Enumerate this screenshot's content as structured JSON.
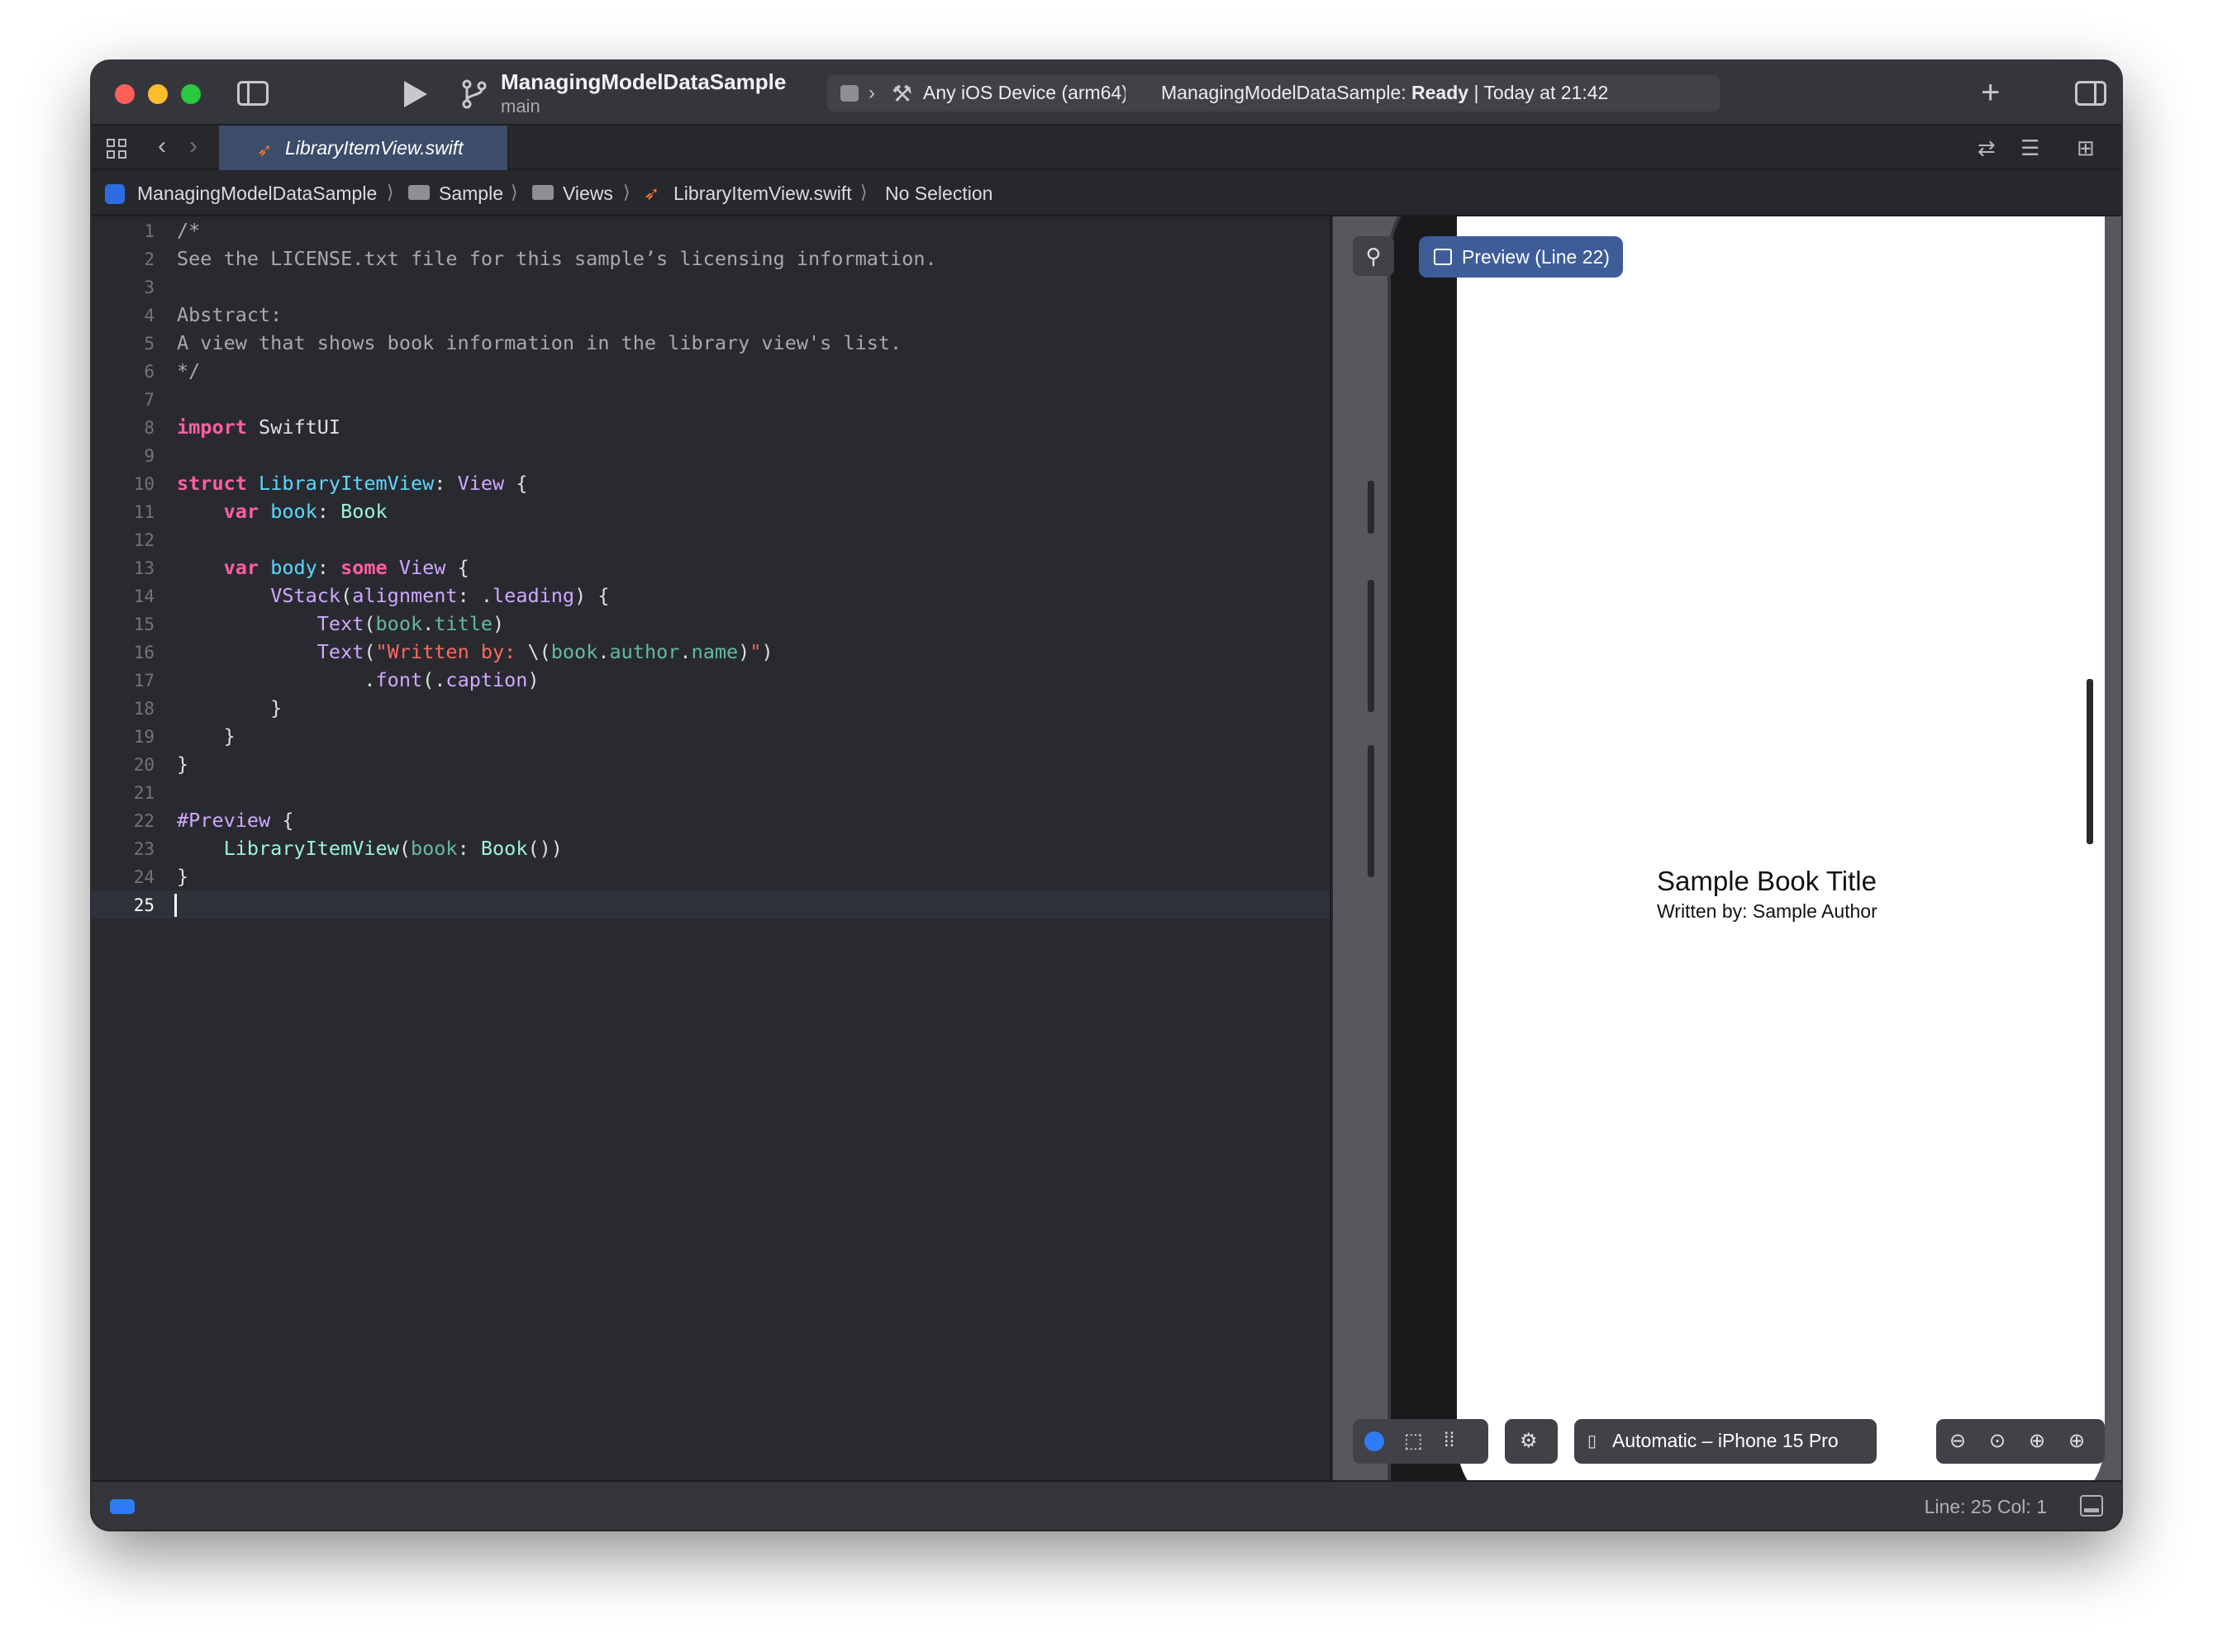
{
  "titlebar": {
    "scheme_name": "ManagingModelDataSample",
    "branch": "main",
    "destination": "Any iOS Device (arm64)",
    "status_project": "ManagingModelDataSample:",
    "status_state": "Ready",
    "status_time": "| Today at 21:42"
  },
  "tab": {
    "label": "LibraryItemView.swift"
  },
  "jumpbar": {
    "items": [
      "ManagingModelDataSample",
      "Sample",
      "Views",
      "LibraryItemView.swift",
      "No Selection"
    ]
  },
  "editor": {
    "current_line": 25,
    "line_numbers": [
      "1",
      "2",
      "3",
      "4",
      "5",
      "6",
      "7",
      "8",
      "9",
      "10",
      "11",
      "12",
      "13",
      "14",
      "15",
      "16",
      "17",
      "18",
      "19",
      "20",
      "21",
      "22",
      "23",
      "24",
      "25"
    ]
  },
  "preview": {
    "pill_label": "Preview (Line 22)",
    "book_title": "Sample Book Title",
    "book_author": "Written by: Sample Author",
    "device_label": "Automatic – iPhone 15 Pro"
  },
  "statusbar": {
    "cursor": "Line: 25  Col: 1"
  },
  "colors": {
    "keyword": "#fc5fa3",
    "type": "#5dd8ff",
    "property": "#67b7a4",
    "string": "#fc6a5d",
    "comment": "#a9a9ad",
    "accent": "#2f7bf5"
  },
  "icons": [
    "sidebar-icon",
    "play-icon",
    "branch-icon",
    "hammer-icon",
    "plus-icon",
    "inspector-icon",
    "grid-icon",
    "chevron-left-icon",
    "chevron-right-icon",
    "swift-icon",
    "folder-icon",
    "pin-icon",
    "zoom-out-icon",
    "zoom-in-icon"
  ]
}
